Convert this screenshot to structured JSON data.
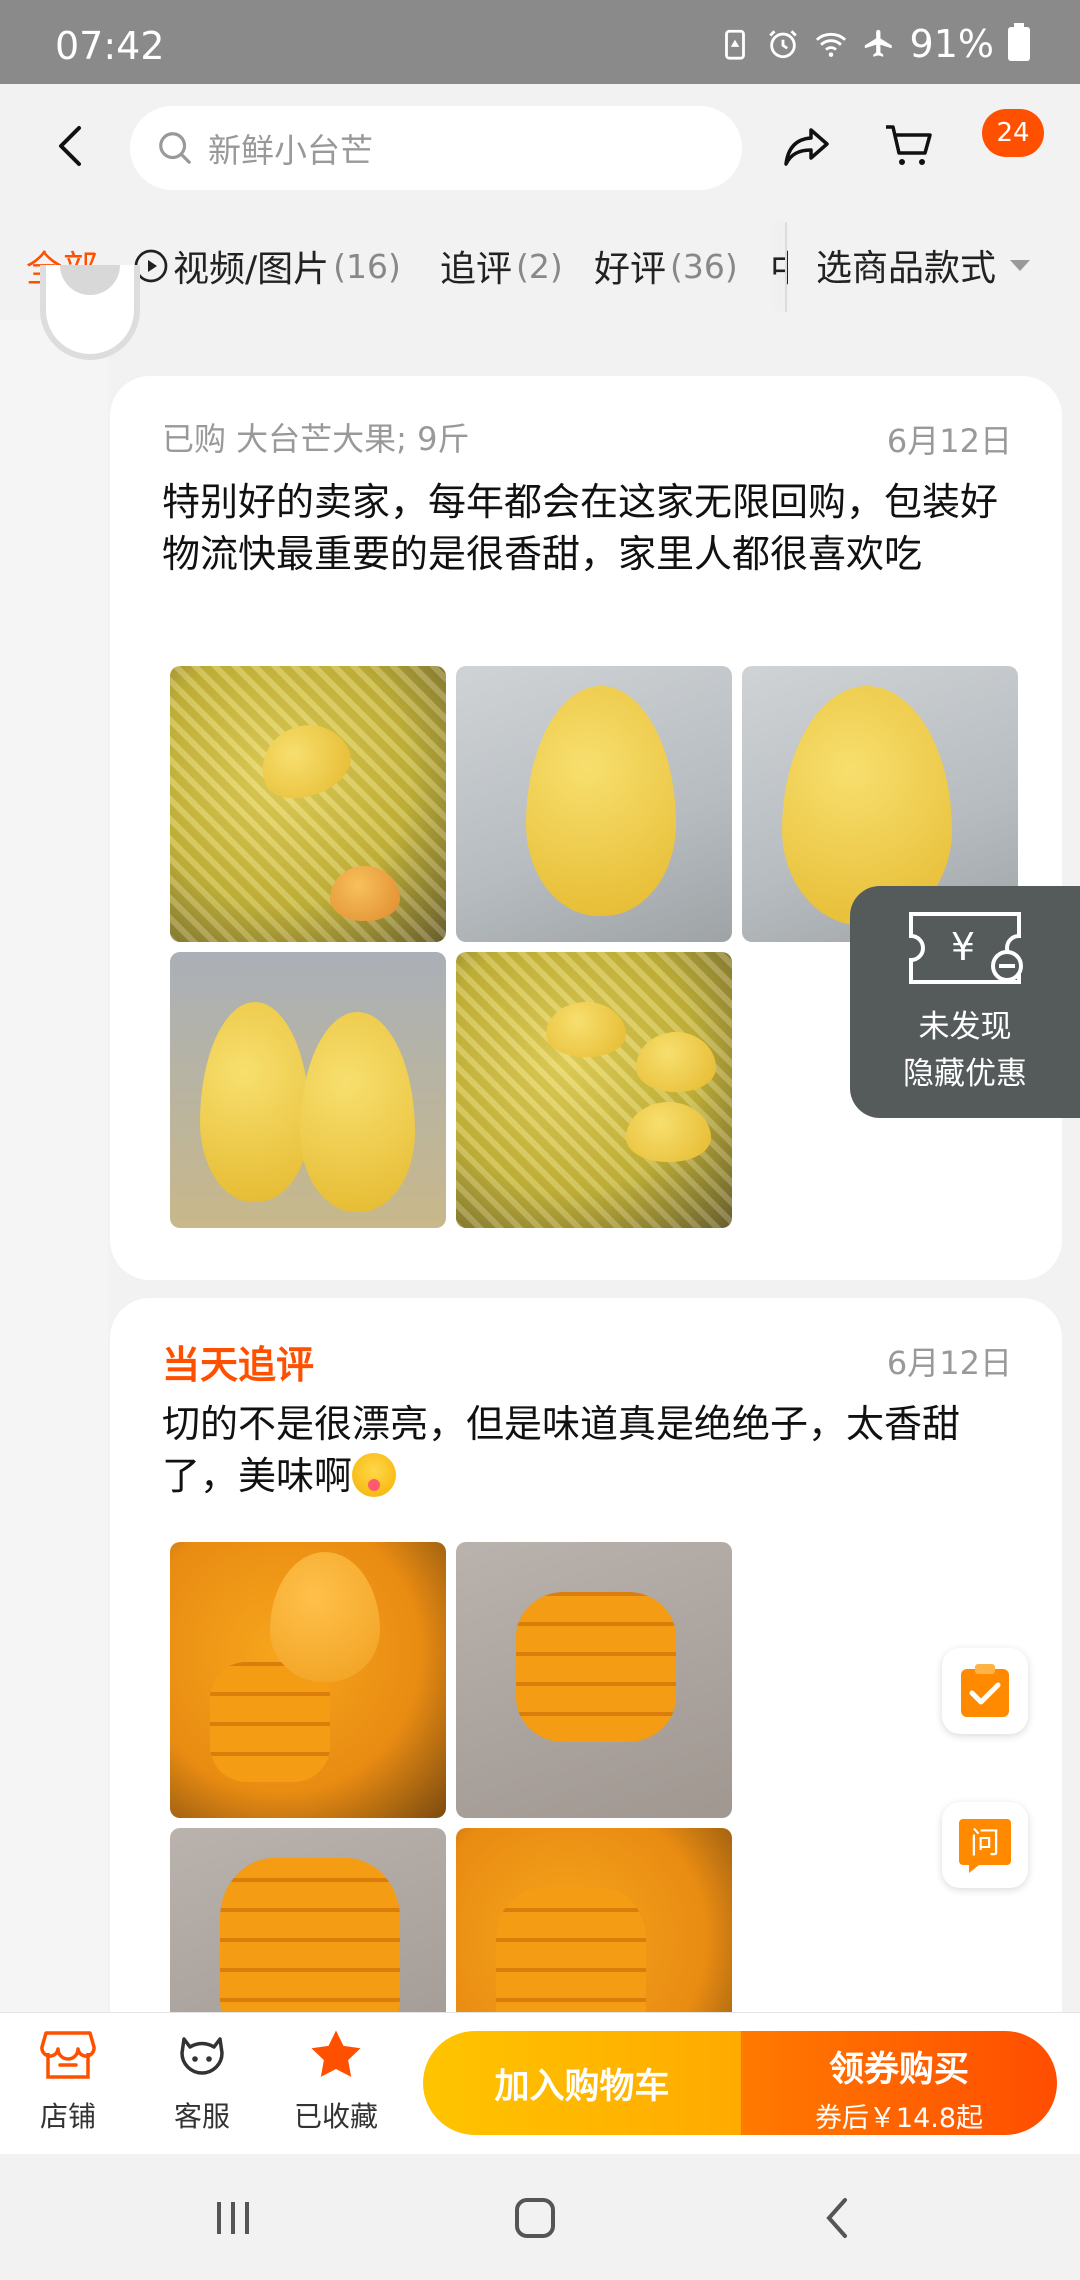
{
  "status_bar": {
    "time": "07:42",
    "battery": "91%"
  },
  "header": {
    "search_placeholder": "新鲜小台芒",
    "message_badge": "24"
  },
  "tabs": [
    {
      "label": "全部",
      "count": ""
    },
    {
      "label": "视频/图片",
      "count": "(16)"
    },
    {
      "label": "追评",
      "count": "(2)"
    },
    {
      "label": "好评",
      "count": "(36)"
    },
    {
      "label": "中",
      "count": ""
    }
  ],
  "style_selector": "选商品款式",
  "review": {
    "purchased": "已购 大台芒大果; 9斤",
    "date": "6月12日",
    "text": "特别好的卖家，每年都会在这家无限回购，包装好物流快最重要的是很香甜，家里人都很喜欢吃"
  },
  "followup": {
    "label": "当天追评",
    "date": "6月12日",
    "text": "切的不是很漂亮，但是味道真是绝绝子，太香甜了，美味啊"
  },
  "coupon_float": {
    "line1": "未发现",
    "line2": "隐藏优惠"
  },
  "side_buttons": {
    "ask": "问"
  },
  "bottom_bar": {
    "shop": "店铺",
    "service": "客服",
    "favorited": "已收藏",
    "add_to_cart": "加入购物车",
    "buy_main": "领券购买",
    "buy_sub": "券后￥14.8起"
  },
  "colors": {
    "accent": "#ff5000",
    "cart_button": "#ffb800",
    "buy_button": "#ff5a00"
  }
}
